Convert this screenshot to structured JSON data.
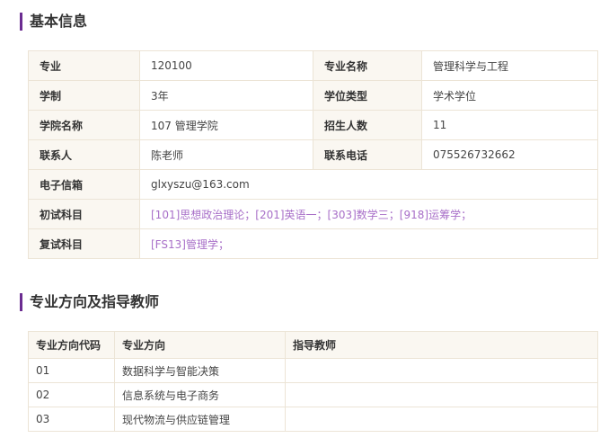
{
  "basic_info": {
    "title": "基本信息",
    "rows": [
      [
        {
          "label": "专业",
          "value": "120100"
        },
        {
          "label": "专业名称",
          "value": "管理科学与工程"
        }
      ],
      [
        {
          "label": "学制",
          "value": "3年"
        },
        {
          "label": "学位类型",
          "value": "学术学位"
        }
      ],
      [
        {
          "label": "学院名称",
          "value": "107 管理学院"
        },
        {
          "label": "招生人数",
          "value": "11"
        }
      ],
      [
        {
          "label": "联系人",
          "value": "陈老师"
        },
        {
          "label": "联系电话",
          "value": "075526732662"
        }
      ]
    ],
    "email_label": "电子信箱",
    "email": "glxyszu@163.com",
    "exam_label": "初试科目",
    "exam_subjects": "[101]思想政治理论；[201]英语一；[303]数学三；[918]运筹学；",
    "retest_label": "复试科目",
    "retest_subjects": "[FS13]管理学；",
    "link_color": "#a86fc8"
  },
  "directions": {
    "title": "专业方向及指导教师",
    "headers": [
      "专业方向代码",
      "专业方向",
      "指导教师"
    ],
    "rows": [
      {
        "code": "01",
        "name": "数据科学与智能决策",
        "tutor": ""
      },
      {
        "code": "02",
        "name": "信息系统与电子商务",
        "tutor": ""
      },
      {
        "code": "03",
        "name": "现代物流与供应链管理",
        "tutor": ""
      }
    ]
  },
  "accent_color": "#6b2c91"
}
